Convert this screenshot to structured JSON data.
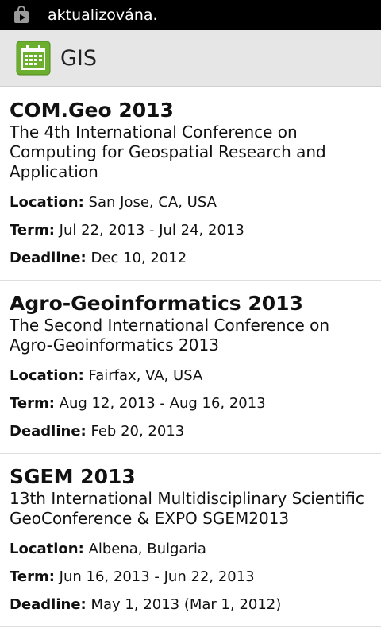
{
  "status_bar": {
    "notification_text": "aktualizována."
  },
  "action_bar": {
    "title": "GIS"
  },
  "labels": {
    "location": "Location:",
    "term": "Term:",
    "deadline": "Deadline:"
  },
  "conferences": [
    {
      "name": "COM.Geo 2013",
      "description": "The 4th International Conference on Computing for Geospatial Research and Application",
      "location": "San Jose, CA, USA",
      "term": "Jul 22, 2013 - Jul 24, 2013",
      "deadline": "Dec 10, 2012"
    },
    {
      "name": "Agro-Geoinformatics 2013",
      "description": "The Second International Conference on Agro-Geoinformatics 2013",
      "location": "Fairfax, VA, USA",
      "term": "Aug 12, 2013 - Aug 16, 2013",
      "deadline": "Feb 20, 2013"
    },
    {
      "name": "SGEM 2013",
      "description": "13th International Multidisciplinary Scientific GeoConference & EXPO SGEM2013",
      "location": "Albena, Bulgaria",
      "term": "Jun 16, 2013 - Jun 22, 2013",
      "deadline": "May 1, 2013 (Mar 1, 2012)"
    }
  ]
}
